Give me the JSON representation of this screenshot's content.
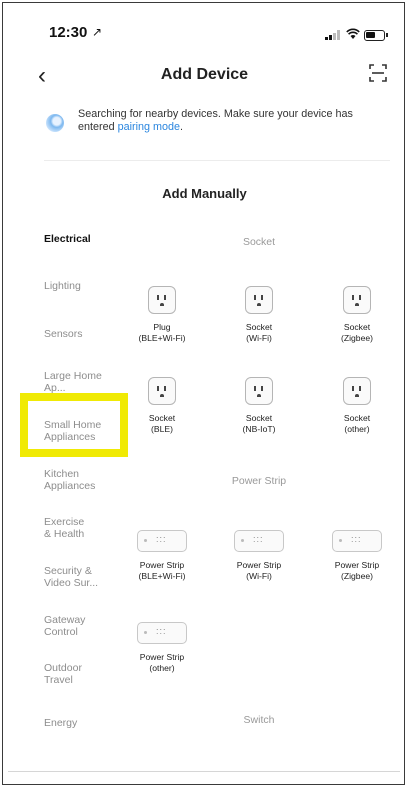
{
  "status_bar": {
    "time": "12:30",
    "location_glyph": "↗"
  },
  "header": {
    "back_glyph": "‹",
    "title": "Add Device"
  },
  "notice": {
    "text": "Searching for nearby devices. Make sure your device has entered ",
    "link": "pairing mode",
    "end": "."
  },
  "section": {
    "title": "Add Manually"
  },
  "sidebar": [
    {
      "label": "Electrical",
      "active": true
    },
    {
      "label": "Lighting"
    },
    {
      "label": "Sensors"
    },
    {
      "label": "Large Home Ap..."
    },
    {
      "label": "Small Home Appliances"
    },
    {
      "label": "Kitchen Appliances"
    },
    {
      "label": "Exercise & Health"
    },
    {
      "label": "Security & Video Sur..."
    },
    {
      "label": "Gateway Control"
    },
    {
      "label": "Outdoor Travel"
    },
    {
      "label": "Energy"
    }
  ],
  "categories": {
    "socket": "Socket",
    "power_strip": "Power Strip",
    "switch": "Switch"
  },
  "devices": {
    "plug": [
      "Plug",
      "(BLE+Wi-Fi)"
    ],
    "socket_wifi": [
      "Socket",
      "(Wi-Fi)"
    ],
    "socket_zigbee": [
      "Socket",
      "(Zigbee)"
    ],
    "socket_ble": [
      "Socket",
      "(BLE)"
    ],
    "socket_nbiot": [
      "Socket",
      "(NB-IoT)"
    ],
    "socket_other": [
      "Socket",
      "(other)"
    ],
    "strip_ble_wifi": [
      "Power Strip",
      "(BLE+Wi-Fi)"
    ],
    "strip_wifi": [
      "Power Strip",
      "(Wi-Fi)"
    ],
    "strip_zigbee": [
      "Power Strip",
      "(Zigbee)"
    ],
    "strip_other": [
      "Power Strip",
      "(other)"
    ]
  },
  "colors": {
    "accent": "#2b86df",
    "highlight": "#f0ea04"
  }
}
